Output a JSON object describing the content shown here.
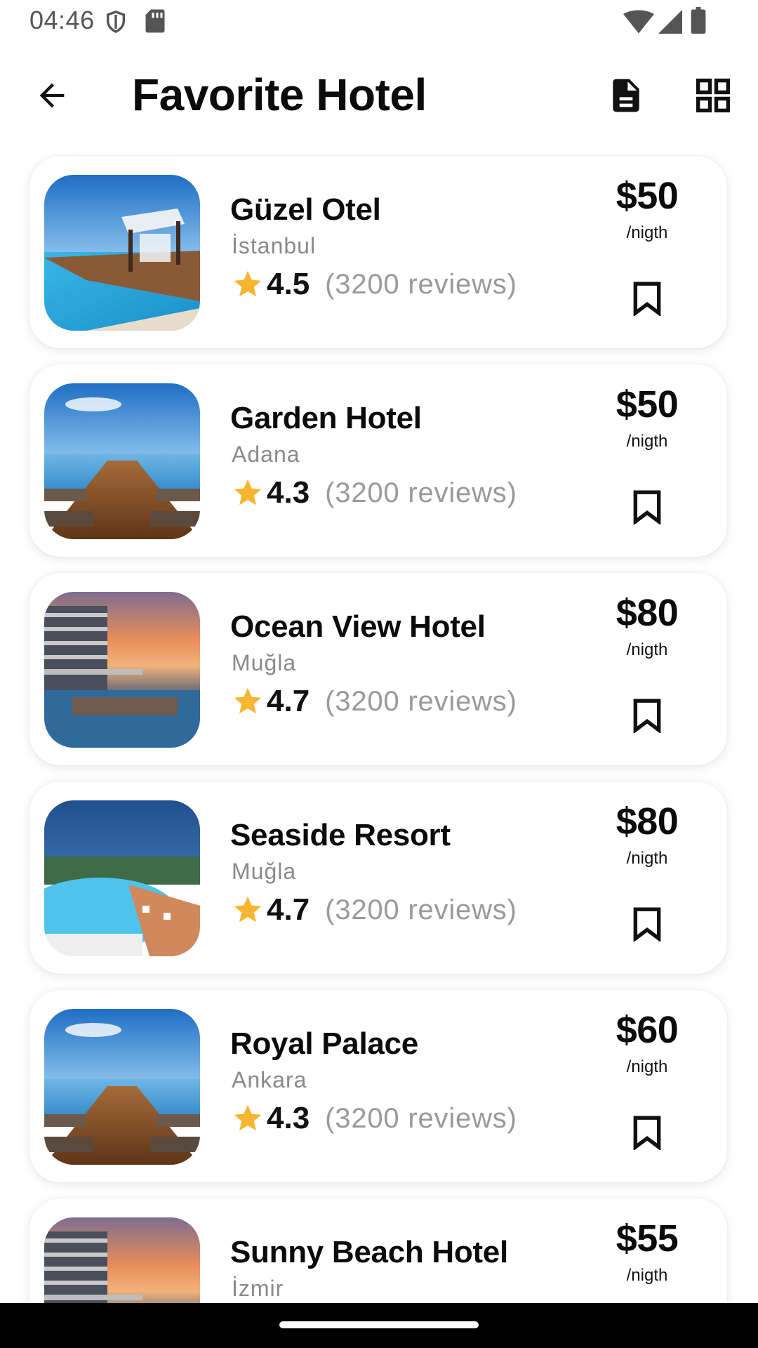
{
  "status_bar": {
    "time": "04:46",
    "left_icons": [
      "shield-icon",
      "sd-card-icon"
    ],
    "right_icons": [
      "wifi-icon",
      "signal-icon",
      "battery-icon"
    ]
  },
  "app_bar": {
    "title": "Favorite Hotel",
    "back_icon": "arrow-back-icon",
    "actions": [
      "document-icon",
      "grid-view-icon"
    ]
  },
  "colors": {
    "star": "#F7B531",
    "text_primary": "#0B0B0B",
    "text_secondary": "#8A8A8A",
    "card_bg": "#FFFFFF"
  },
  "hotels": [
    {
      "name": "Güzel Otel",
      "city": "İstanbul",
      "rating": "4.5",
      "reviews": "(3200 reviews)",
      "price": "$50",
      "per_night": "/nigth",
      "image": "pool-cabana-photo"
    },
    {
      "name": "Garden Hotel",
      "city": "Adana",
      "rating": "4.3",
      "reviews": "(3200 reviews)",
      "price": "$50",
      "per_night": "/nigth",
      "image": "wooden-pier-photo"
    },
    {
      "name": "Ocean View Hotel",
      "city": "Muğla",
      "rating": "4.7",
      "reviews": "(3200 reviews)",
      "price": "$80",
      "per_night": "/nigth",
      "image": "sunset-hotel-photo"
    },
    {
      "name": "Seaside Resort",
      "city": "Muğla",
      "rating": "4.7",
      "reviews": "(3200 reviews)",
      "price": "$80",
      "per_night": "/nigth",
      "image": "resort-pool-photo"
    },
    {
      "name": "Royal Palace",
      "city": "Ankara",
      "rating": "4.3",
      "reviews": "(3200 reviews)",
      "price": "$60",
      "per_night": "/nigth",
      "image": "wooden-pier-photo"
    },
    {
      "name": "Sunny Beach Hotel",
      "city": "İzmir",
      "rating": "",
      "reviews": "",
      "price": "$55",
      "per_night": "/nigth",
      "image": "sunset-hotel-photo"
    }
  ]
}
